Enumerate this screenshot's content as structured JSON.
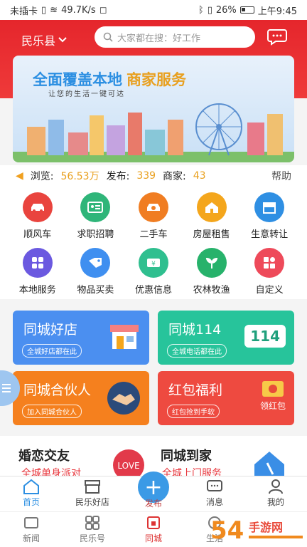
{
  "status": {
    "carrier": "未插卡",
    "speed": "49.7K/s",
    "battery": "26%",
    "time": "上午9:45"
  },
  "header": {
    "location": "民乐县",
    "search_placeholder": "大家都在搜：好工作"
  },
  "banner": {
    "title_a": "全面覆盖本地",
    "title_b": "商家服务",
    "subtitle": "让您的生活一键可达"
  },
  "stats": {
    "views_label": "浏览:",
    "views": "56.53万",
    "posts_label": "发布:",
    "posts": "339",
    "merchants_label": "商家:",
    "merchants": "43",
    "help": "帮助"
  },
  "categories": [
    {
      "label": "顺风车",
      "icon": "car-icon",
      "color": "#e9443e"
    },
    {
      "label": "求职招聘",
      "icon": "id-card-icon",
      "color": "#2fb579"
    },
    {
      "label": "二手车",
      "icon": "used-car-icon",
      "color": "#f07d22"
    },
    {
      "label": "房屋租售",
      "icon": "house-icon",
      "color": "#f4a61c"
    },
    {
      "label": "生意转让",
      "icon": "shop-icon",
      "color": "#2f8fe3"
    },
    {
      "label": "本地服务",
      "icon": "grid-icon",
      "color": "#6b59e0"
    },
    {
      "label": "物品买卖",
      "icon": "tag-icon",
      "color": "#3f8ff0"
    },
    {
      "label": "优惠信息",
      "icon": "ticket-icon",
      "color": "#2fbf8f"
    },
    {
      "label": "农林牧渔",
      "icon": "leaf-icon",
      "color": "#27b26b"
    },
    {
      "label": "自定义",
      "icon": "apps-icon",
      "color": "#ee4a5a"
    }
  ],
  "cards": [
    {
      "title": "同城好店",
      "tag": "全城好店都在此",
      "color": "#4b8ff0"
    },
    {
      "title": "同城114",
      "tag": "全城电话都在此",
      "color": "#27c49b",
      "badge": "114"
    },
    {
      "title": "同城合伙人",
      "tag": "加入同城合伙人",
      "color": "#f5801e"
    },
    {
      "title": "红包福利",
      "tag": "红包抢到手软",
      "color": "#ee4a40",
      "badge": "领红包"
    }
  ],
  "lower": {
    "left_title": "婚恋交友",
    "left_sub": "全城单身派对",
    "right_title": "同城到家",
    "right_sub": "全城上门服务"
  },
  "tabbar": [
    "首页",
    "民乐好店",
    "发布",
    "消息",
    "我的"
  ],
  "tabbar2": [
    "新闻",
    "民乐号",
    "同城",
    "生活"
  ]
}
